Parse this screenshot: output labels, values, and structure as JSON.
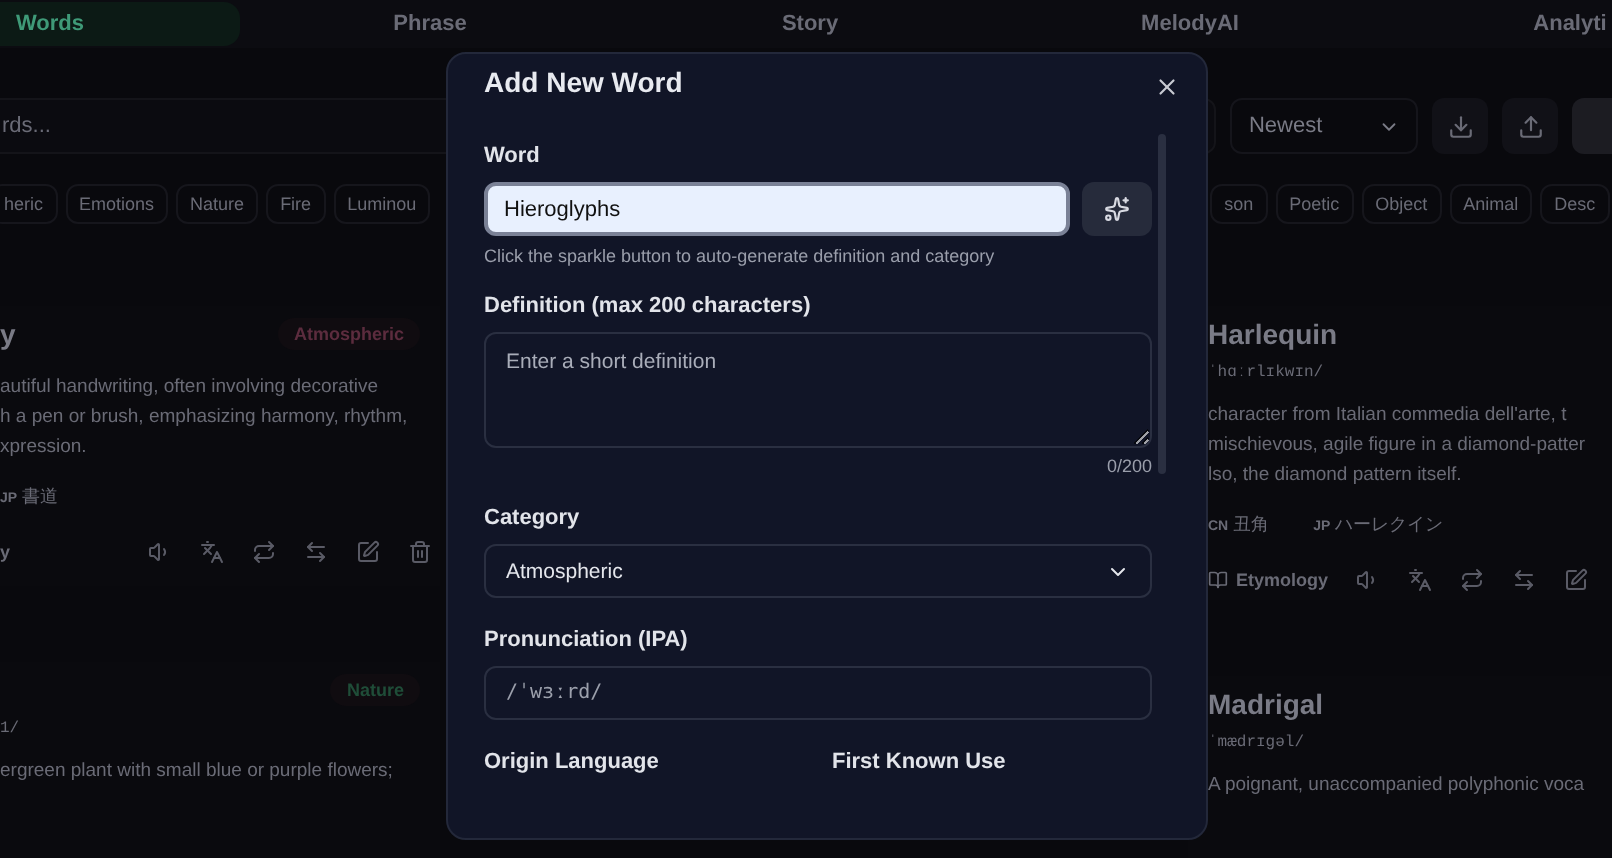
{
  "nav": {
    "tabs": [
      {
        "label": "Words",
        "selected": true
      },
      {
        "label": "Phrase",
        "selected": false
      },
      {
        "label": "Story",
        "selected": false
      },
      {
        "label": "MelodyAI",
        "selected": false
      },
      {
        "label": "Analyti",
        "selected": false
      }
    ]
  },
  "toolbar": {
    "search": {
      "placeholder": "rds..."
    },
    "sort": {
      "value": "Newest"
    }
  },
  "categories_left": [
    "heric",
    "Emotions",
    "Nature",
    "Fire",
    "Luminou"
  ],
  "categories_right": [
    "son",
    "Poetic",
    "Object",
    "Animal",
    "Desc"
  ],
  "cards_left": [
    {
      "title": "y",
      "tag": {
        "label": "Atmospheric",
        "color": "#5c2c3e"
      },
      "definition": [
        "autiful handwriting, often involving decorative",
        "h a pen or brush, emphasizing harmony, rhythm,",
        "xpression."
      ],
      "translations": [
        {
          "lang": "JP",
          "text": "書道"
        }
      ],
      "footer": "y"
    },
    {
      "tag": {
        "label": "Nature",
        "color": "#1f4d38"
      },
      "ipa": "1/",
      "definition": [
        "ergreen plant with small blue or purple flowers;"
      ]
    }
  ],
  "cards_right": [
    {
      "title": "Harlequin",
      "ipa": "ˈhɑːrlɪkwɪn/",
      "definition": [
        "character from Italian commedia dell'arte, t",
        "mischievous, agile figure in a diamond-patter",
        "lso, the diamond pattern itself."
      ],
      "translations": [
        {
          "lang": "CN",
          "text": "丑角"
        },
        {
          "lang": "JP",
          "text": "ハーレクイン"
        }
      ],
      "footer": "Etymology"
    },
    {
      "title": "Madrigal",
      "ipa": "ˈmædrɪɡəl/",
      "definition": [
        "A poignant, unaccompanied polyphonic voca"
      ]
    }
  ],
  "modal": {
    "title": "Add New Word",
    "word": {
      "label": "Word",
      "value": "Hieroglyphs",
      "hint": "Click the sparkle button to auto-generate definition and category"
    },
    "definition": {
      "label": "Definition (max 200 characters)",
      "placeholder": "Enter a short definition",
      "counter": "0/200"
    },
    "category": {
      "label": "Category",
      "value": "Atmospheric"
    },
    "pronunciation": {
      "label": "Pronunciation (IPA)",
      "placeholder": "/ˈwɜːrd/"
    },
    "origin_language": {
      "label": "Origin Language"
    },
    "first_known_use": {
      "label": "First Known Use"
    }
  }
}
